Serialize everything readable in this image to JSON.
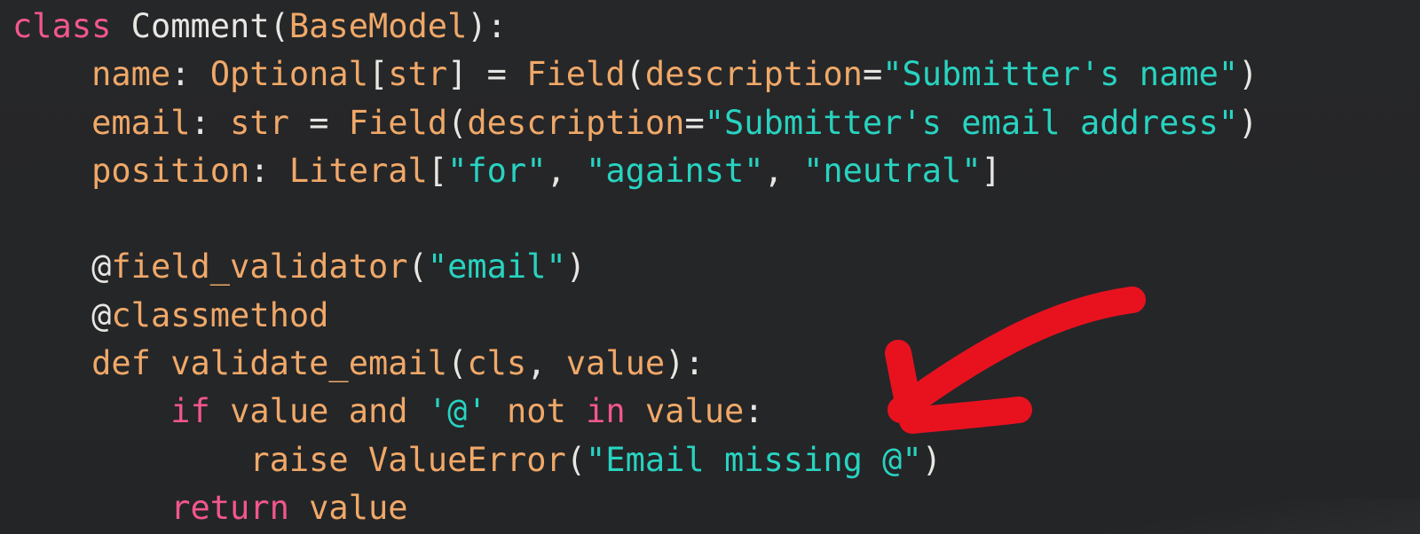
{
  "code": {
    "lines": [
      {
        "indent": "",
        "tokens": [
          {
            "t": "kw",
            "v": "class"
          },
          {
            "t": "txt",
            "v": " Comment("
          },
          {
            "t": "fn",
            "v": "BaseModel"
          },
          {
            "t": "txt",
            "v": "):"
          }
        ]
      },
      {
        "indent": "    ",
        "tokens": [
          {
            "t": "fn",
            "v": "name"
          },
          {
            "t": "txt",
            "v": ": "
          },
          {
            "t": "fn",
            "v": "Optional"
          },
          {
            "t": "txt",
            "v": "["
          },
          {
            "t": "fn",
            "v": "str"
          },
          {
            "t": "txt",
            "v": "] = "
          },
          {
            "t": "fn",
            "v": "Field"
          },
          {
            "t": "txt",
            "v": "("
          },
          {
            "t": "fn",
            "v": "description"
          },
          {
            "t": "txt",
            "v": "="
          },
          {
            "t": "str",
            "v": "\"Submitter's name\""
          },
          {
            "t": "txt",
            "v": ")"
          }
        ]
      },
      {
        "indent": "    ",
        "tokens": [
          {
            "t": "fn",
            "v": "email"
          },
          {
            "t": "txt",
            "v": ": "
          },
          {
            "t": "fn",
            "v": "str"
          },
          {
            "t": "txt",
            "v": " = "
          },
          {
            "t": "fn",
            "v": "Field"
          },
          {
            "t": "txt",
            "v": "("
          },
          {
            "t": "fn",
            "v": "description"
          },
          {
            "t": "txt",
            "v": "="
          },
          {
            "t": "str",
            "v": "\"Submitter's email address\""
          },
          {
            "t": "txt",
            "v": ")"
          }
        ]
      },
      {
        "indent": "    ",
        "tokens": [
          {
            "t": "fn",
            "v": "position"
          },
          {
            "t": "txt",
            "v": ": "
          },
          {
            "t": "fn",
            "v": "Literal"
          },
          {
            "t": "txt",
            "v": "["
          },
          {
            "t": "str",
            "v": "\"for\""
          },
          {
            "t": "txt",
            "v": ", "
          },
          {
            "t": "str",
            "v": "\"against\""
          },
          {
            "t": "txt",
            "v": ", "
          },
          {
            "t": "str",
            "v": "\"neutral\""
          },
          {
            "t": "txt",
            "v": "]"
          }
        ]
      },
      {
        "indent": "",
        "tokens": []
      },
      {
        "indent": "    ",
        "tokens": [
          {
            "t": "txt",
            "v": "@"
          },
          {
            "t": "fn",
            "v": "field_validator"
          },
          {
            "t": "txt",
            "v": "("
          },
          {
            "t": "str",
            "v": "\"email\""
          },
          {
            "t": "txt",
            "v": ")"
          }
        ]
      },
      {
        "indent": "    ",
        "tokens": [
          {
            "t": "txt",
            "v": "@"
          },
          {
            "t": "fn",
            "v": "classmethod"
          }
        ]
      },
      {
        "indent": "    ",
        "tokens": [
          {
            "t": "fn",
            "v": "def"
          },
          {
            "t": "txt",
            "v": " "
          },
          {
            "t": "fn",
            "v": "validate_email"
          },
          {
            "t": "txt",
            "v": "("
          },
          {
            "t": "fn",
            "v": "cls"
          },
          {
            "t": "txt",
            "v": ", "
          },
          {
            "t": "fn",
            "v": "value"
          },
          {
            "t": "txt",
            "v": "):"
          }
        ]
      },
      {
        "indent": "        ",
        "tokens": [
          {
            "t": "kw",
            "v": "if"
          },
          {
            "t": "txt",
            "v": " "
          },
          {
            "t": "fn",
            "v": "value"
          },
          {
            "t": "txt",
            "v": " "
          },
          {
            "t": "fn",
            "v": "and"
          },
          {
            "t": "txt",
            "v": " "
          },
          {
            "t": "str",
            "v": "'@'"
          },
          {
            "t": "txt",
            "v": " "
          },
          {
            "t": "fn",
            "v": "not"
          },
          {
            "t": "txt",
            "v": " "
          },
          {
            "t": "kw",
            "v": "in"
          },
          {
            "t": "txt",
            "v": " "
          },
          {
            "t": "fn",
            "v": "value"
          },
          {
            "t": "txt",
            "v": ":"
          }
        ]
      },
      {
        "indent": "            ",
        "tokens": [
          {
            "t": "fn",
            "v": "raise"
          },
          {
            "t": "txt",
            "v": " "
          },
          {
            "t": "fn",
            "v": "ValueError"
          },
          {
            "t": "txt",
            "v": "("
          },
          {
            "t": "str",
            "v": "\"Email missing @\""
          },
          {
            "t": "txt",
            "v": ")"
          }
        ]
      },
      {
        "indent": "        ",
        "tokens": [
          {
            "t": "kw",
            "v": "return"
          },
          {
            "t": "txt",
            "v": " "
          },
          {
            "t": "fn",
            "v": "value"
          }
        ]
      }
    ]
  },
  "colors": {
    "background": "#252628",
    "keyword": "#f2568d",
    "identifier": "#f0a868",
    "string": "#28d3c0",
    "plain": "#e8e6e3",
    "arrow": "#e8121f"
  },
  "annotation": {
    "icon": "hand-drawn-arrow-icon"
  }
}
